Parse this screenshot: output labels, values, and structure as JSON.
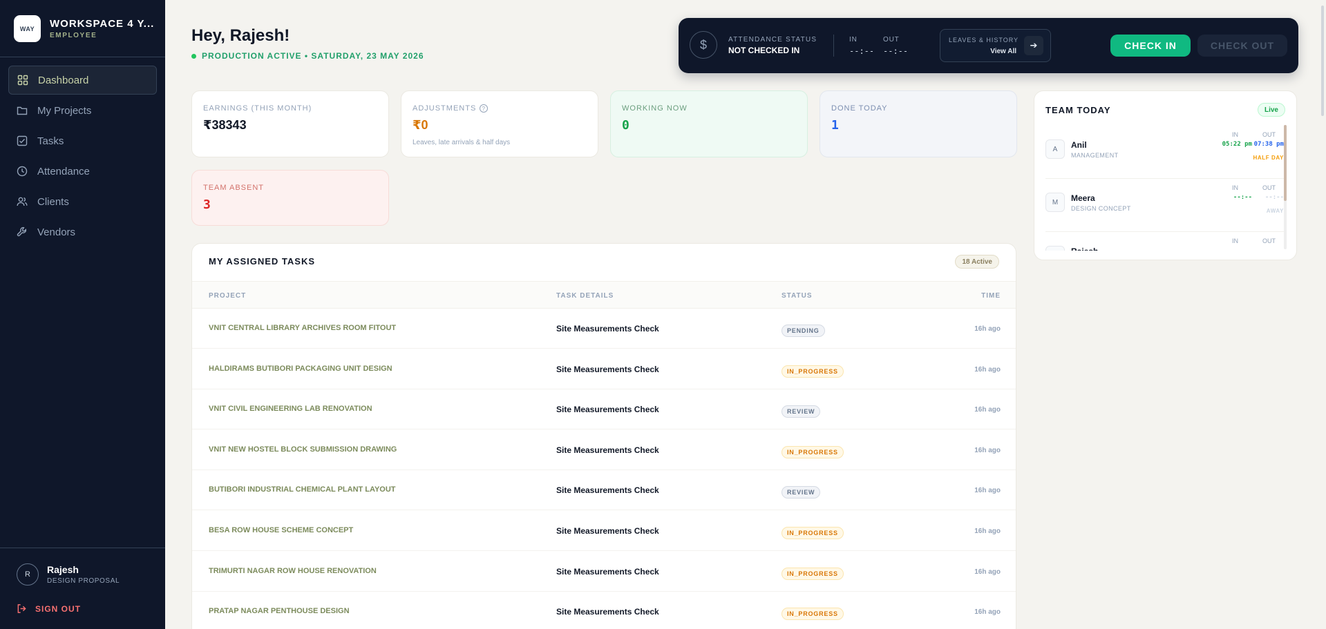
{
  "sidebar": {
    "brand_logo": "WAY",
    "brand_name": "WORKSPACE 4 Y...",
    "brand_role": "EMPLOYEE",
    "nav": [
      {
        "label": "Dashboard",
        "icon": "grid-icon",
        "active": true
      },
      {
        "label": "My Projects",
        "icon": "folder-icon",
        "active": false
      },
      {
        "label": "Tasks",
        "icon": "checkbox-icon",
        "active": false
      },
      {
        "label": "Attendance",
        "icon": "clock-icon",
        "active": false
      },
      {
        "label": "Clients",
        "icon": "users-icon",
        "active": false
      },
      {
        "label": "Vendors",
        "icon": "wrench-icon",
        "active": false
      }
    ],
    "user": {
      "initial": "R",
      "name": "Rajesh",
      "role": "DESIGN PROPOSAL"
    },
    "signout_label": "SIGN OUT"
  },
  "header": {
    "greeting": "Hey, Rajesh!",
    "status_line": "PRODUCTION ACTIVE • SATURDAY, 23 MAY 2026"
  },
  "attendance": {
    "status_label": "ATTENDANCE STATUS",
    "status_value": "NOT CHECKED IN",
    "in_label": "IN",
    "in_value": "--:--",
    "out_label": "OUT",
    "out_value": "--:--",
    "leaves_label": "LEAVES & HISTORY",
    "leaves_view": "View All",
    "checkin_label": "CHECK IN",
    "checkout_label": "CHECK OUT"
  },
  "stats": {
    "earnings": {
      "label": "EARNINGS (THIS MONTH)",
      "value": "₹38343"
    },
    "adjustments": {
      "label": "ADJUSTMENTS",
      "value": "₹0",
      "sub": "Leaves, late arrivals & half days"
    },
    "working": {
      "label": "WORKING NOW",
      "value": "0"
    },
    "done": {
      "label": "DONE TODAY",
      "value": "1"
    },
    "absent": {
      "label": "TEAM ABSENT",
      "value": "3"
    }
  },
  "tasks": {
    "title": "MY ASSIGNED TASKS",
    "badge": "18 Active",
    "columns": {
      "project": "PROJECT",
      "details": "TASK DETAILS",
      "status": "STATUS",
      "time": "TIME"
    },
    "rows": [
      {
        "project": "VNIT CENTRAL LIBRARY ARCHIVES ROOM FITOUT",
        "task": "Site Measurements Check",
        "status": "PENDING",
        "time": "16h ago"
      },
      {
        "project": "HALDIRAMS BUTIBORI PACKAGING UNIT DESIGN",
        "task": "Site Measurements Check",
        "status": "IN_PROGRESS",
        "time": "16h ago"
      },
      {
        "project": "VNIT CIVIL ENGINEERING LAB RENOVATION",
        "task": "Site Measurements Check",
        "status": "REVIEW",
        "time": "16h ago"
      },
      {
        "project": "VNIT NEW HOSTEL BLOCK SUBMISSION DRAWING",
        "task": "Site Measurements Check",
        "status": "IN_PROGRESS",
        "time": "16h ago"
      },
      {
        "project": "BUTIBORI INDUSTRIAL CHEMICAL PLANT LAYOUT",
        "task": "Site Measurements Check",
        "status": "REVIEW",
        "time": "16h ago"
      },
      {
        "project": "BESA ROW HOUSE SCHEME CONCEPT",
        "task": "Site Measurements Check",
        "status": "IN_PROGRESS",
        "time": "16h ago"
      },
      {
        "project": "TRIMURTI NAGAR ROW HOUSE RENOVATION",
        "task": "Site Measurements Check",
        "status": "IN_PROGRESS",
        "time": "16h ago"
      },
      {
        "project": "PRATAP NAGAR PENTHOUSE DESIGN",
        "task": "Site Measurements Check",
        "status": "IN_PROGRESS",
        "time": "16h ago"
      }
    ]
  },
  "team": {
    "title": "TEAM TODAY",
    "live": "Live",
    "members": [
      {
        "initial": "A",
        "name": "Anil",
        "dept": "MANAGEMENT",
        "in_label": "IN",
        "out_label": "OUT",
        "in": "05:22 pm",
        "out": "07:38 pm",
        "flag": "HALF DAY",
        "flag_color": "#f59e0b",
        "out_color": "#2563eb",
        "in_color": "#16a34a"
      },
      {
        "initial": "M",
        "name": "Meera",
        "dept": "DESIGN CONCEPT",
        "in_label": "IN",
        "out_label": "OUT",
        "in": "--:--",
        "out": "--:--",
        "flag": "AWAY",
        "flag_color": "#cbd5e1",
        "out_color": "#cbd5e1",
        "in_color": "#16a34a"
      },
      {
        "initial": "",
        "name": "Rajesh",
        "dept": "",
        "in_label": "IN",
        "out_label": "OUT",
        "in": "",
        "out": "",
        "flag": "",
        "flag_color": "#cbd5e1",
        "out_color": "#cbd5e1",
        "in_color": "#16a34a"
      }
    ]
  },
  "colors": {
    "sidebar_bg": "#0f172a",
    "accent_green": "#10b981",
    "working_card_bg": "#effaf4",
    "done_card_bg": "#f3f5f9",
    "absent_card_bg": "#fdf1f0",
    "adjust_value": "#d97706",
    "working_value": "#16a34a",
    "done_value": "#2563eb",
    "absent_value": "#dc2626"
  }
}
